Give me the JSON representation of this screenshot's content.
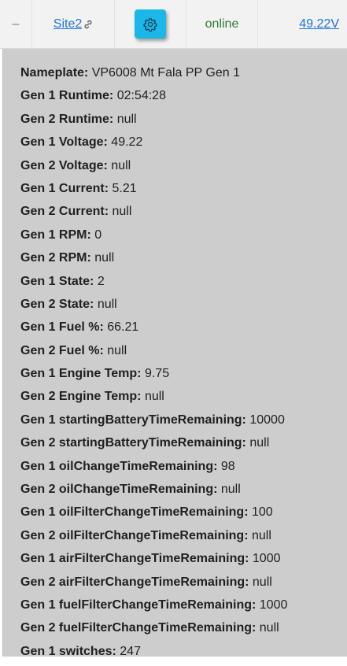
{
  "header": {
    "collapse_symbol": "–",
    "site_name": "Site2",
    "link_icon": "link-icon",
    "settings_icon": "gear-icon",
    "status": "online",
    "voltage": "49.22V",
    "colors": {
      "accent": "#1bb7e8",
      "status_online": "#2e7d32",
      "link": "#1e73d8"
    }
  },
  "details": [
    {
      "label": "Nameplate:",
      "value": "VP6008 Mt Fala PP Gen 1"
    },
    {
      "label": "Gen 1 Runtime:",
      "value": "02:54:28"
    },
    {
      "label": "Gen 2 Runtime:",
      "value": "null"
    },
    {
      "label": "Gen 1 Voltage:",
      "value": "49.22"
    },
    {
      "label": "Gen 2 Voltage:",
      "value": "null"
    },
    {
      "label": "Gen 1 Current:",
      "value": "5.21"
    },
    {
      "label": "Gen 2 Current:",
      "value": "null"
    },
    {
      "label": "Gen 1 RPM:",
      "value": "0"
    },
    {
      "label": "Gen 2 RPM:",
      "value": "null"
    },
    {
      "label": "Gen 1 State:",
      "value": "2"
    },
    {
      "label": "Gen 2 State:",
      "value": "null"
    },
    {
      "label": "Gen 1 Fuel %:",
      "value": "66.21"
    },
    {
      "label": "Gen 2 Fuel %:",
      "value": "null"
    },
    {
      "label": "Gen 1 Engine Temp:",
      "value": "9.75"
    },
    {
      "label": "Gen 2 Engine Temp:",
      "value": "null"
    },
    {
      "label": "Gen 1 startingBatteryTimeRemaining:",
      "value": "10000"
    },
    {
      "label": "Gen 2 startingBatteryTimeRemaining:",
      "value": "null"
    },
    {
      "label": "Gen 1 oilChangeTimeRemaining:",
      "value": "98"
    },
    {
      "label": "Gen 2 oilChangeTimeRemaining:",
      "value": "null"
    },
    {
      "label": "Gen 1 oilFilterChangeTimeRemaining:",
      "value": "100"
    },
    {
      "label": "Gen 2 oilFilterChangeTimeRemaining:",
      "value": "null"
    },
    {
      "label": "Gen 1 airFilterChangeTimeRemaining:",
      "value": "1000"
    },
    {
      "label": "Gen 2 airFilterChangeTimeRemaining:",
      "value": "null"
    },
    {
      "label": "Gen 1 fuelFilterChangeTimeRemaining:",
      "value": "1000"
    },
    {
      "label": "Gen 2 fuelFilterChangeTimeRemaining:",
      "value": "null"
    },
    {
      "label": "Gen 1 switches:",
      "value": "247"
    }
  ]
}
